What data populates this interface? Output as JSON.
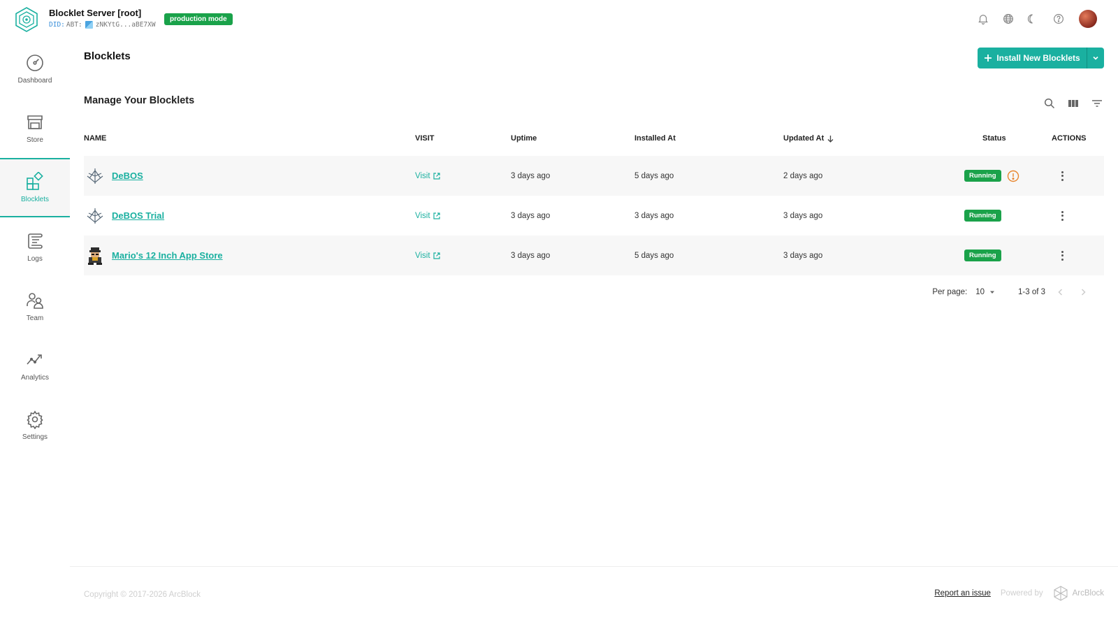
{
  "header": {
    "title": "Blocklet Server [root]",
    "did_prefix": "DID:",
    "did_type": "ABT:",
    "did_value": "zNKYtG...aBE7XW",
    "mode_badge": "production mode",
    "icons": [
      "bell-icon",
      "globe-icon",
      "moon-icon",
      "help-icon"
    ]
  },
  "sidebar": {
    "items": [
      {
        "label": "Dashboard",
        "icon": "dashboard-icon"
      },
      {
        "label": "Store",
        "icon": "store-icon"
      },
      {
        "label": "Blocklets",
        "icon": "blocklets-icon",
        "active": true
      },
      {
        "label": "Logs",
        "icon": "logs-icon"
      },
      {
        "label": "Team",
        "icon": "team-icon"
      },
      {
        "label": "Analytics",
        "icon": "analytics-icon"
      },
      {
        "label": "Settings",
        "icon": "settings-icon"
      }
    ]
  },
  "main": {
    "page_title": "Blocklets",
    "install_button": "Install New Blocklets",
    "section_title": "Manage Your Blocklets",
    "columns": {
      "name": "NAME",
      "visit": "VISIT",
      "uptime": "Uptime",
      "installed": "Installed At",
      "updated": "Updated At",
      "status": "Status",
      "actions": "ACTIONS"
    },
    "rows": [
      {
        "name": "DeBOS",
        "visit": "Visit",
        "uptime": "3 days ago",
        "installed": "5 days ago",
        "updated": "2 days ago",
        "status": "Running",
        "warning": true
      },
      {
        "name": "DeBOS Trial",
        "visit": "Visit",
        "uptime": "3 days ago",
        "installed": "3 days ago",
        "updated": "3 days ago",
        "status": "Running",
        "warning": false
      },
      {
        "name": "Mario's 12 Inch App Store",
        "visit": "Visit",
        "uptime": "3 days ago",
        "installed": "5 days ago",
        "updated": "3 days ago",
        "status": "Running",
        "warning": false
      }
    ],
    "pagination": {
      "per_page_label": "Per page:",
      "per_page_value": "10",
      "range": "1-3 of 3"
    }
  },
  "footer": {
    "copyright": "Copyright © 2017-2026  ArcBlock",
    "report_link": "Report an issue",
    "powered_by": "Powered by",
    "brand": "ArcBlock"
  },
  "colors": {
    "accent": "#1ab0a0",
    "running": "#1aa24a",
    "warning": "#e8862f"
  }
}
